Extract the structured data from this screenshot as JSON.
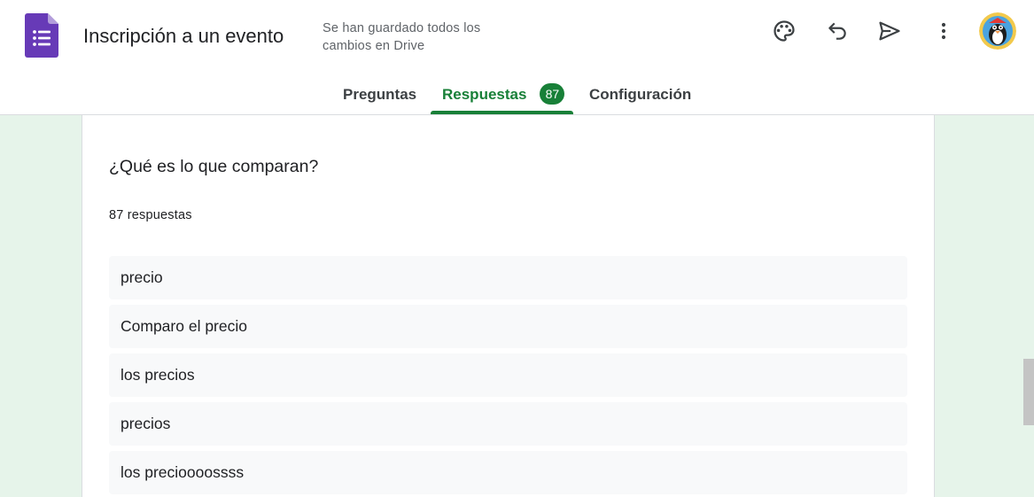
{
  "header": {
    "title": "Inscripción a un evento",
    "save_status": "Se han guardado todos los cambios en Drive",
    "icons": {
      "app": "google-forms-icon",
      "palette": "palette-icon",
      "undo": "undo-icon",
      "send": "send-icon",
      "more": "more-vert-icon",
      "avatar": "user-avatar"
    }
  },
  "tabs": [
    {
      "label": "Preguntas",
      "active": false
    },
    {
      "label": "Respuestas",
      "active": true,
      "badge": "87"
    },
    {
      "label": "Configuración",
      "active": false
    }
  ],
  "question": {
    "title": "¿Qué es lo que comparan?",
    "response_count": "87 respuestas",
    "answers": [
      "precio",
      "Comparo el precio",
      "los precios",
      "precios",
      "los precioooossss"
    ]
  },
  "colors": {
    "accent": "#188038",
    "background": "#e6f4ea",
    "forms_purple": "#673ab7"
  }
}
